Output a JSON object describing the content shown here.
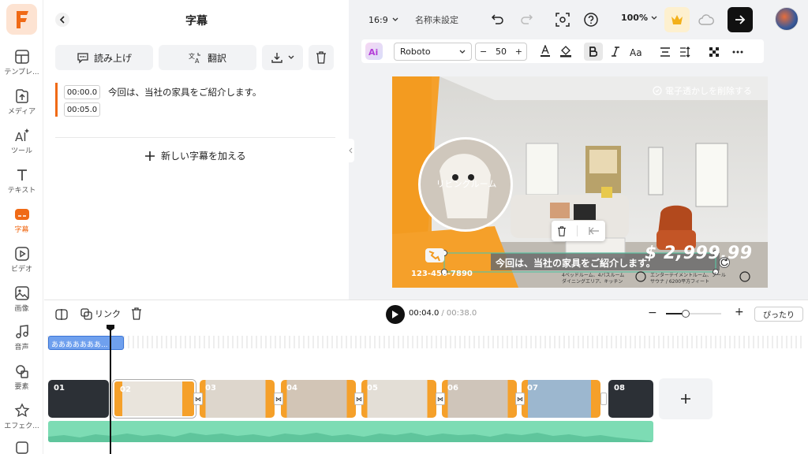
{
  "sidebar": {
    "items": [
      {
        "label": "テンプレ..."
      },
      {
        "label": "メディア"
      },
      {
        "label": "ツール"
      },
      {
        "label": "テキスト"
      },
      {
        "label": "字幕"
      },
      {
        "label": "ビデオ"
      },
      {
        "label": "画像"
      },
      {
        "label": "音声"
      },
      {
        "label": "要素"
      },
      {
        "label": "エフェク..."
      }
    ],
    "active_color": "#f06a16"
  },
  "panel": {
    "title": "字幕",
    "read_aloud": "読み上げ",
    "translate": "翻訳",
    "subtitle": {
      "start": "00:00.0",
      "end": "00:05.0",
      "text": "今回は、当社の家具をご紹介します。"
    },
    "add_subtitle": "新しい字幕を加える"
  },
  "topbar": {
    "aspect": "16:9",
    "project_name": "名称未設定",
    "zoom": "100%"
  },
  "format": {
    "font": "Roboto",
    "size": "50"
  },
  "canvas": {
    "watermark": "電子透かしを削除する",
    "circle_label": "リビングルーム",
    "caption": "今回は、当社の家具をご紹介します。",
    "price": "$ 2,999.99",
    "phone": "123-456-7890",
    "feature1": "4ベッドルーム、4バスルーム",
    "feature1b": "ダイニングエリア、キッチン",
    "feature2": "エンターテイメントルーム、プール",
    "feature2b": "サウナ / 6200平方フィート"
  },
  "timeline": {
    "link_label": "リンク",
    "current_time": "00:04.0",
    "total_time": "/ 00:38.0",
    "fit_label": "ぴったり",
    "text_track_label": "あああああああ...",
    "clips": [
      "01",
      "02",
      "03",
      "04",
      "05",
      "06",
      "07",
      "08"
    ],
    "accent": "#f5a02a",
    "audio_color": "#7ddcb4"
  }
}
